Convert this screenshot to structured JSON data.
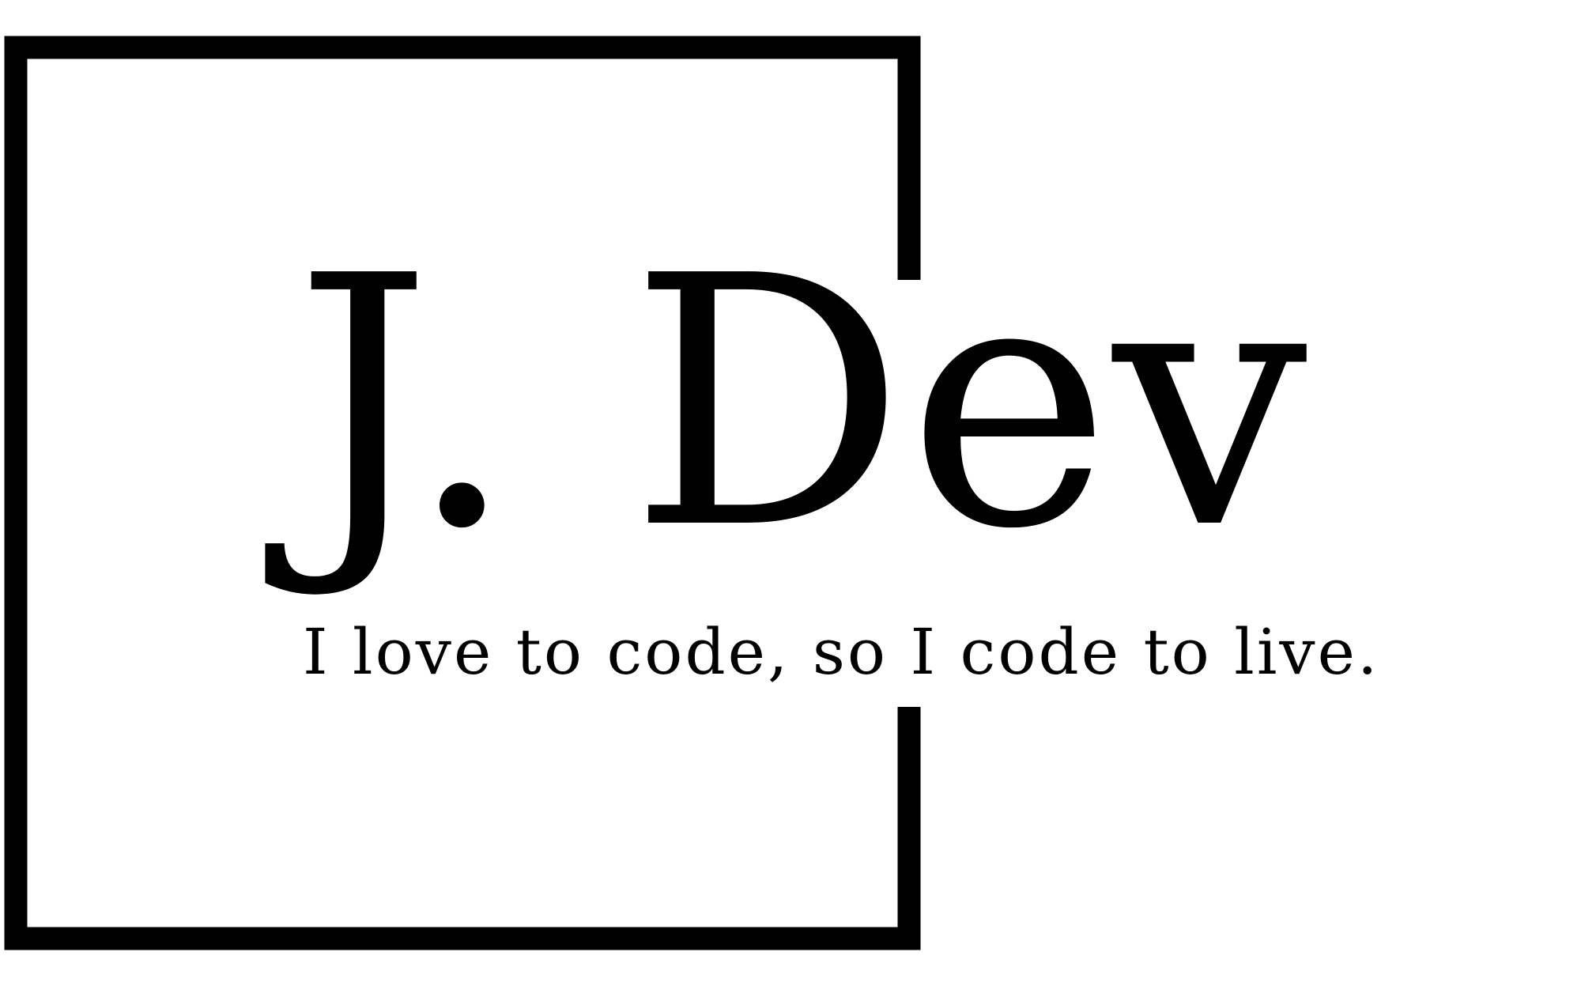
{
  "logo": {
    "wordmark": "J. Dev",
    "tagline": "I love to code, so I code to live."
  },
  "colors": {
    "foreground": "#000000",
    "background": "#ffffff"
  }
}
